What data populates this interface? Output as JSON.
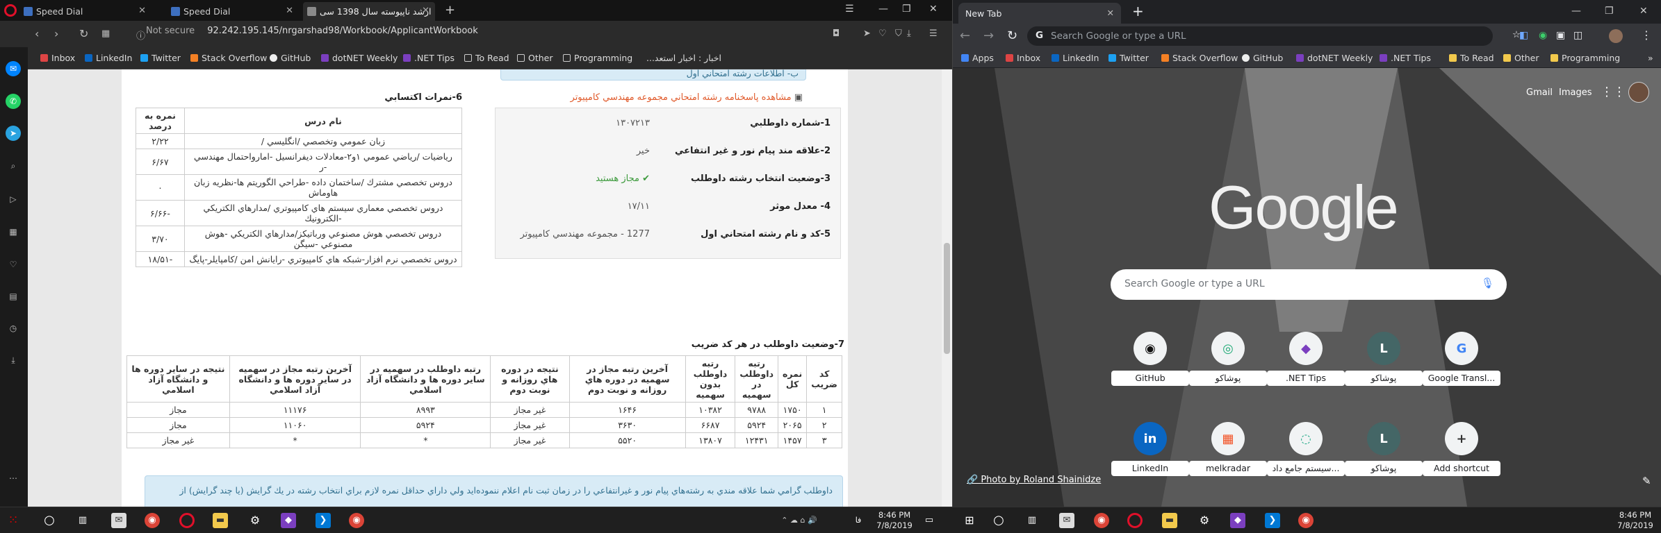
{
  "opera": {
    "tabs": [
      {
        "title": "Speed Dial"
      },
      {
        "title": "Speed Dial"
      },
      {
        "title": "ارشد ناپیوسته سال 1398 سی"
      }
    ],
    "address": {
      "security": "Not secure",
      "url": "92.242.195.145/nrgarshad98/Workbook/ApplicantWorkbook"
    },
    "bookmarks": [
      "Inbox",
      "LinkedIn",
      "Twitter",
      "Stack Overflow",
      "GitHub",
      "dotNET Weekly",
      ".NET Tips",
      "To Read",
      "Other",
      "Programming",
      "اخبار : اخبار استعد..."
    ]
  },
  "page": {
    "section_top": "ب- اطلاعات رشته امتحاني اول",
    "answer_link": "مشاهده پاسخنامه رشته امتحاني مجموعه مهندسي كامپيوتر",
    "info": [
      {
        "label": "1-شماره داوطلبي",
        "value": "۱۳۰۷۲۱۳"
      },
      {
        "label": "2-علاقه مند پيام نور و غير انتفاعي",
        "value": "خير"
      },
      {
        "label": "3-وضعيت انتخاب رشته داوطلب",
        "value": "مجاز هستيد"
      },
      {
        "label": "4- معدل موثر",
        "value": "۱۷/۱۱"
      },
      {
        "label": "5-كد و نام رشته امتحاني اول",
        "value": "1277 - مجموعه مهندسي كامپيوتر"
      }
    ],
    "scores_title": "6-نمرات اكتسابي",
    "scores_headers": [
      "نام درس",
      "نمره به درصد"
    ],
    "scores": [
      {
        "course": "زبان عمومي وتخصصي /انگليسي /",
        "score": "۲/۲۲"
      },
      {
        "course": "رياضيات /رياضي عمومي ۱و۲-معادلات ديفرانسيل -امارواحتمال مهندسي -ر",
        "score": "۶/۶۷"
      },
      {
        "course": "دروس تخصصي مشترك /ساختمان داده -طراحي الگوريتم ها-نظريه زبان هاوماش",
        "score": "۰"
      },
      {
        "course": "دروس تخصصي معماري سيستم هاي كامپيوتري /مدارهاي الكتريكي -الكترونيك",
        "score": "-۶/۶۶"
      },
      {
        "course": "دروس تخصصي هوش مصنوعي ورباتيكز/مدارهاي الكتريكي -هوش مصنوعي -سيگن",
        "score": "۳/۷۰"
      },
      {
        "course": "دروس تخصصي نرم افزار-شبكه هاي كامپيوتري -رايانش امن /كامپايلر-پايگ",
        "score": "-۱۸/۵۱"
      }
    ],
    "status_title": "7-وضعيت داوطلب در هر كد ضريب",
    "status_headers": [
      "كد ضريب",
      "نمره كل",
      "رتبه داوطلب در سهميه",
      "رتبه داوطلب بدون سهميه",
      "آخرين رتبه مجاز در سهميه در دوره هاي روزانه و نوبت دوم",
      "نتيجه در دوره هاي روزانه و نوبت دوم",
      "رتبه داوطلب در سهميه در ساير دوره ها و دانشگاه آزاد اسلامي",
      "آخرين رتبه مجاز در سهميه در ساير دوره ها و دانشگاه آزاد اسلامي",
      "نتيجه در ساير دوره ها و دانشگاه آزاد اسلامي"
    ],
    "status_rows": [
      [
        "۱",
        "۱۷۵۰",
        "۹۷۸۸",
        "۱۰۳۸۲",
        "۱۶۴۶",
        "غير مجاز",
        "۸۹۹۳",
        "۱۱۱۷۶",
        "مجاز"
      ],
      [
        "۲",
        "۲۰۶۵",
        "۵۹۲۴",
        "۶۶۸۷",
        "۳۶۳۰",
        "غير مجاز",
        "۵۹۲۴",
        "۱۱۰۶۰",
        "مجاز"
      ],
      [
        "۳",
        "۱۴۵۷",
        "۱۲۴۳۱",
        "۱۳۸۰۷",
        "۵۵۲۰",
        "غير مجاز",
        "*",
        "*",
        "غير مجاز"
      ]
    ],
    "notice": "داوطلب گرامي شما علاقه مندي به رشته‌هاي پيام نور و غيرانتفاعي را در زمان ثبت نام اعلام ننموده‌ايد ولي داراي حداقل نمره لازم براي انتخاب رشته در يك گرايش (يا چند گرايش) از"
  },
  "chrome": {
    "tab_title": "New Tab",
    "omnibox_placeholder": "Search Google or type a URL",
    "bookmarks": [
      "Apps",
      "Inbox",
      "LinkedIn",
      "Twitter",
      "Stack Overflow",
      "GitHub",
      "dotNET Weekly",
      ".NET Tips",
      "To Read",
      "Other",
      "Programming"
    ],
    "top_links": [
      "Gmail",
      "Images"
    ],
    "logo": "Google",
    "search_placeholder": "Search Google or type a URL",
    "shortcuts": [
      {
        "label": "GitHub",
        "glyph": "◉"
      },
      {
        "label": "پوشاکو",
        "glyph": "◎"
      },
      {
        "label": ".NET Tips",
        "glyph": "◆"
      },
      {
        "label": "پوشاکو",
        "glyph": "L"
      },
      {
        "label": "Google Transl...",
        "glyph": "G"
      },
      {
        "label": "LinkedIn",
        "glyph": "in"
      },
      {
        "label": "melkradar",
        "glyph": "▦"
      },
      {
        "label": "سیستم جامع داد...",
        "glyph": "◌"
      },
      {
        "label": "پوشاکو",
        "glyph": "L"
      },
      {
        "label": "Add shortcut",
        "glyph": "+"
      }
    ],
    "photo_credit": "Photo by Roland Shainidze"
  },
  "taskbar": {
    "left_time": "8:46 PM",
    "left_date": "7/8/2019",
    "lang": "فا",
    "right_time": "8:46 PM",
    "right_date": "7/8/2019"
  }
}
